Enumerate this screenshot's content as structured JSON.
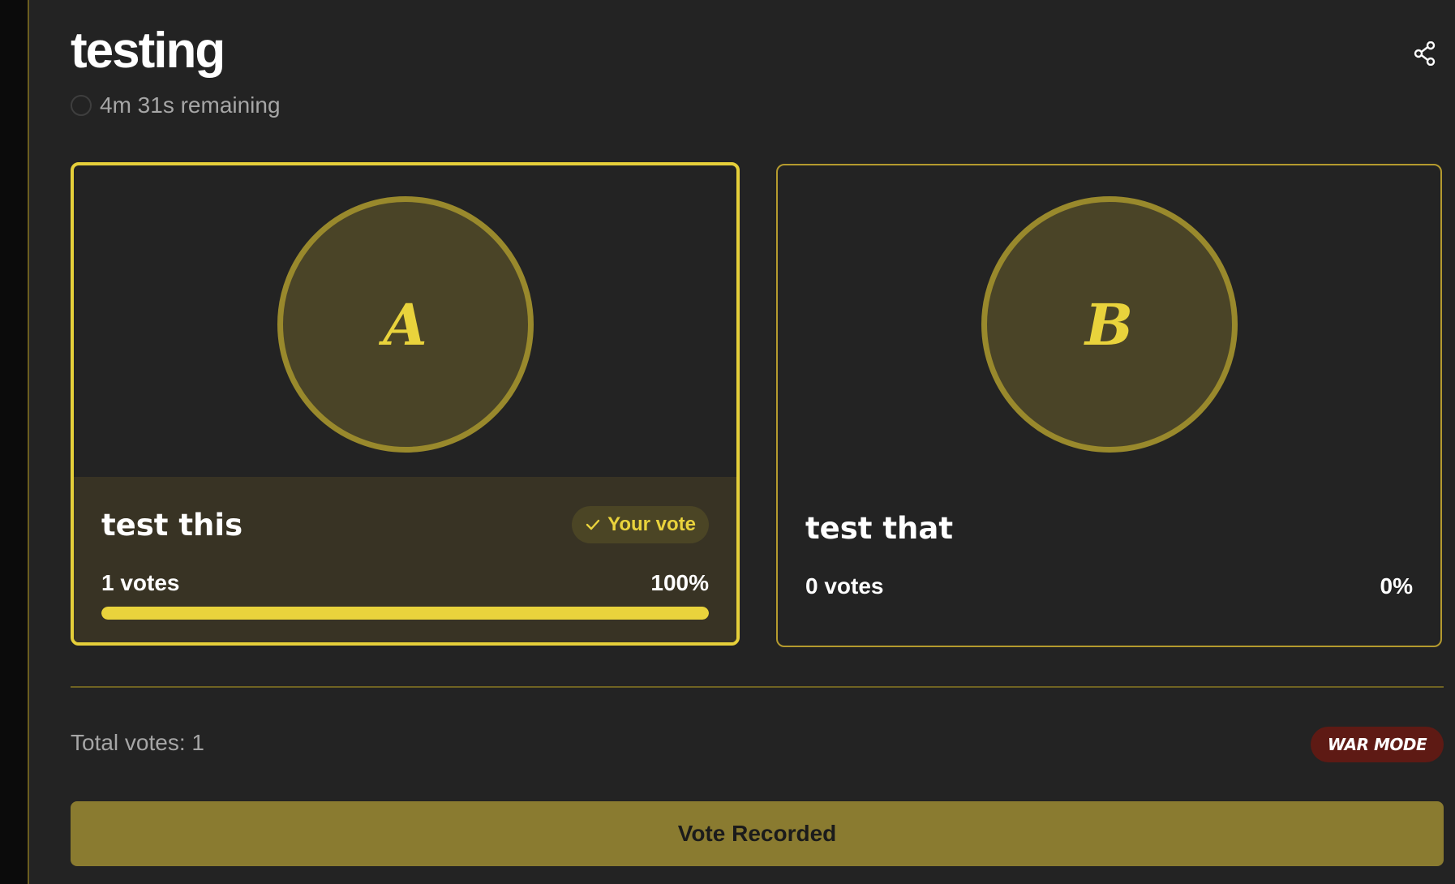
{
  "poll": {
    "title": "testing",
    "timer_text": "4m 31s remaining"
  },
  "icons": {
    "share": "share-icon",
    "timer": "timer-ring-icon",
    "check": "check-icon"
  },
  "options": [
    {
      "letter": "A",
      "title": "test this",
      "your_vote_label": "Your vote",
      "votes_text": "1 votes",
      "percent_text": "100%",
      "percent_value": 100,
      "selected": true
    },
    {
      "letter": "B",
      "title": "test that",
      "votes_text": "0 votes",
      "percent_text": "0%",
      "percent_value": 0,
      "selected": false
    }
  ],
  "footer": {
    "total_votes_text": "Total votes: 1",
    "mode_badge": "WAR MODE",
    "button_label": "Vote Recorded"
  },
  "colors": {
    "accent": "#e9d33c",
    "background": "#232323",
    "button": "#8a7b30",
    "badge": "#5e1a14"
  }
}
